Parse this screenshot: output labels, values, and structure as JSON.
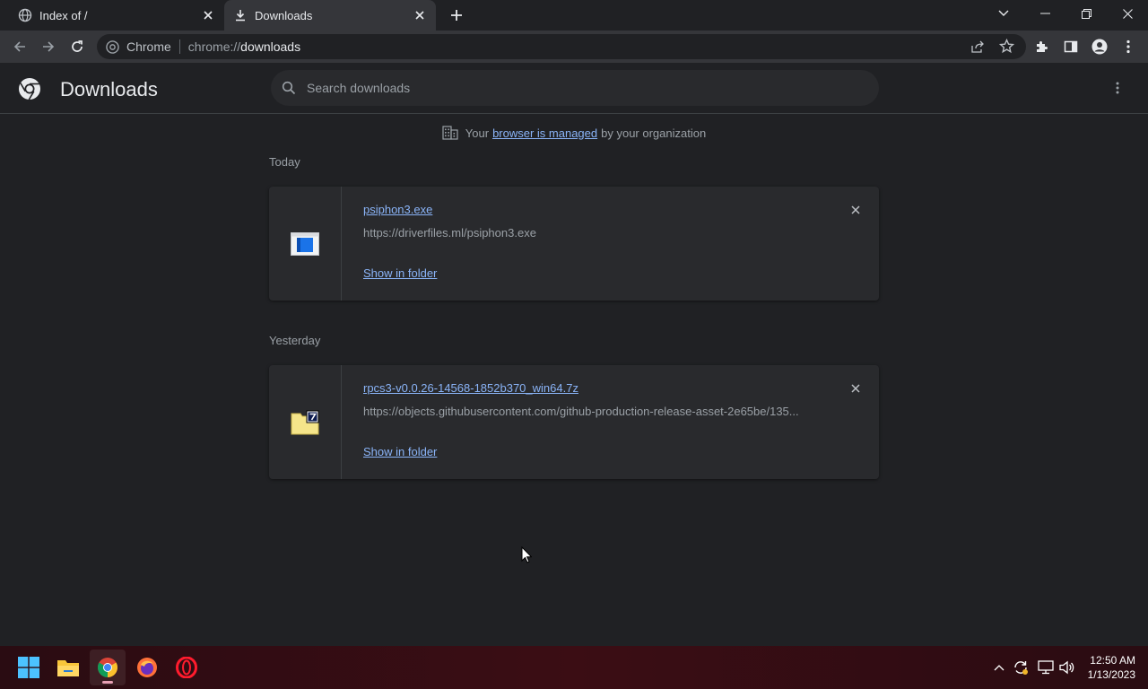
{
  "tabs": [
    {
      "title": "Index of /",
      "icon": "globe-icon",
      "active": false
    },
    {
      "title": "Downloads",
      "icon": "download-icon",
      "active": true
    }
  ],
  "omnibox": {
    "site_chip": "Chrome",
    "url_prefix": "chrome://",
    "url_path": "downloads"
  },
  "page": {
    "title": "Downloads",
    "search_placeholder": "Search downloads",
    "managed_prefix": "Your",
    "managed_link": "browser is managed",
    "managed_suffix": "by your organization"
  },
  "sections": [
    {
      "label": "Today",
      "items": [
        {
          "filename": "psiphon3.exe",
          "url": "https://driverfiles.ml/psiphon3.exe",
          "action": "Show in folder",
          "icon": "exe-file-icon"
        }
      ]
    },
    {
      "label": "Yesterday",
      "items": [
        {
          "filename": "rpcs3-v0.0.26-14568-1852b370_win64.7z",
          "url": "https://objects.githubusercontent.com/github-production-release-asset-2e65be/135...",
          "action": "Show in folder",
          "icon": "7z-archive-icon"
        }
      ]
    }
  ],
  "taskbar": {
    "time": "12:50 AM",
    "date": "1/13/2023"
  },
  "colors": {
    "background": "#202124",
    "toolbar": "#35363a",
    "link": "#8ab4f8",
    "card": "#292a2d"
  }
}
